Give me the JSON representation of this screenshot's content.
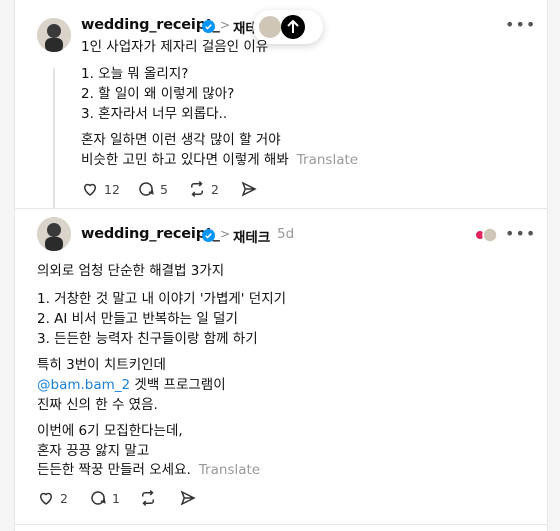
{
  "post1": {
    "username": "wedding_receipt_",
    "topic": "재테",
    "title": "1인 사업자가 제자리 걸음인 이유",
    "list": [
      "1. 오늘 뭐 올리지?",
      "2. 할 일이 왜 이렇게 많아?",
      "3. 혼자라서 너무 외롭다.."
    ],
    "body": [
      "혼자 일하면 이런 생각 많이 할 거야",
      "비슷한 고민 하고 있다면 이렇게 해봐"
    ],
    "translate": "Translate",
    "likes": "12",
    "comments": "5",
    "reposts": "2"
  },
  "post2": {
    "username": "wedding_receipt_",
    "topic": "재테크",
    "time": "5d",
    "intro": "의외로 엄청 단순한 해결법 3가지",
    "list": [
      "1. 거창한 것 말고 내 이야기 '가볍게' 던지기",
      "2. AI 비서 만들고 반복하는 일 덜기",
      "3. 든든한 능력자 친구들이랑 함께 하기"
    ],
    "para1": "특히 3번이 치트키인데",
    "mention": "@bam.bam_2",
    "mention_tail": " 겟백 프로그램이",
    "para1_end": "진짜 신의 한 수 였음.",
    "closing": [
      "이번에 6기 모집한다는데,",
      "혼자 끙끙 앓지 말고",
      "든든한 짝꿍 만들러 오세요."
    ],
    "translate": "Translate",
    "likes": "2",
    "comments": "1"
  },
  "colors": {
    "verified": "#0095f6",
    "mention": "#1d82d6",
    "muted": "#999999"
  }
}
